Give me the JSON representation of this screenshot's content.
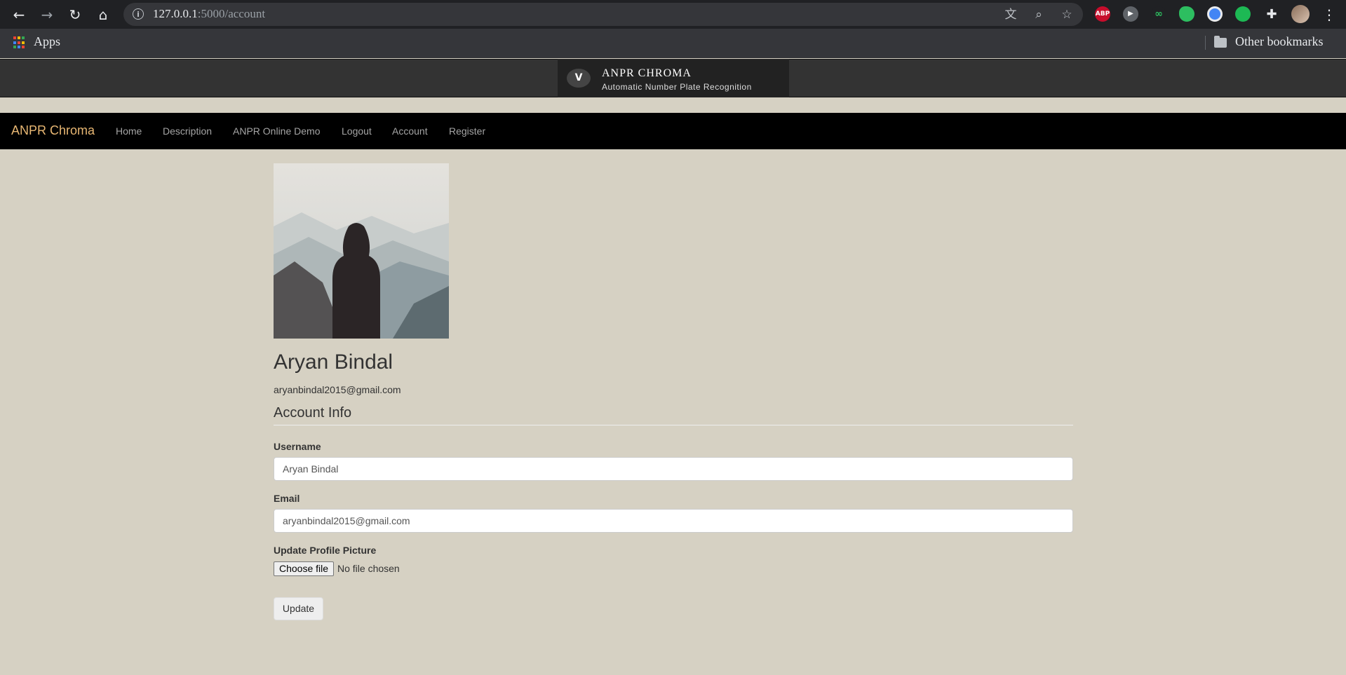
{
  "browser": {
    "url_host": "127.0.0.1",
    "url_path": ":5000/account",
    "bookmarks": {
      "apps_label": "Apps",
      "other_label": "Other bookmarks"
    },
    "extensions": [
      {
        "name": "abp",
        "label": "ABP",
        "color": "#c70d2c"
      },
      {
        "name": "play",
        "label": "▶",
        "color": "#5f6368"
      },
      {
        "name": "mendeley",
        "label": "∞",
        "color": "#202124"
      },
      {
        "name": "evernote",
        "label": "",
        "color": "#2dbe60"
      },
      {
        "name": "vpn",
        "label": "",
        "color": "#4285f4"
      },
      {
        "name": "green-ext",
        "label": "",
        "color": "#1db954"
      }
    ]
  },
  "site": {
    "logo_title": "ANPR CHROMA",
    "logo_subtitle": "Automatic Number Plate Recognition",
    "logo_mark": "V"
  },
  "nav": {
    "brand": "ANPR Chroma",
    "links": [
      "Home",
      "Description",
      "ANPR Online Demo",
      "Logout",
      "Account",
      "Register"
    ]
  },
  "profile": {
    "name": "Aryan Bindal",
    "email": "aryanbindal2015@gmail.com"
  },
  "form": {
    "legend": "Account Info",
    "username_label": "Username",
    "username_value": "Aryan Bindal",
    "email_label": "Email",
    "email_value": "aryanbindal2015@gmail.com",
    "picture_label": "Update Profile Picture",
    "choose_file": "Choose file",
    "no_file": "No file chosen",
    "submit": "Update"
  },
  "colors": {
    "page_bg": "#d6d1c3",
    "brand": "#e8b773",
    "navbar": "#000000"
  }
}
